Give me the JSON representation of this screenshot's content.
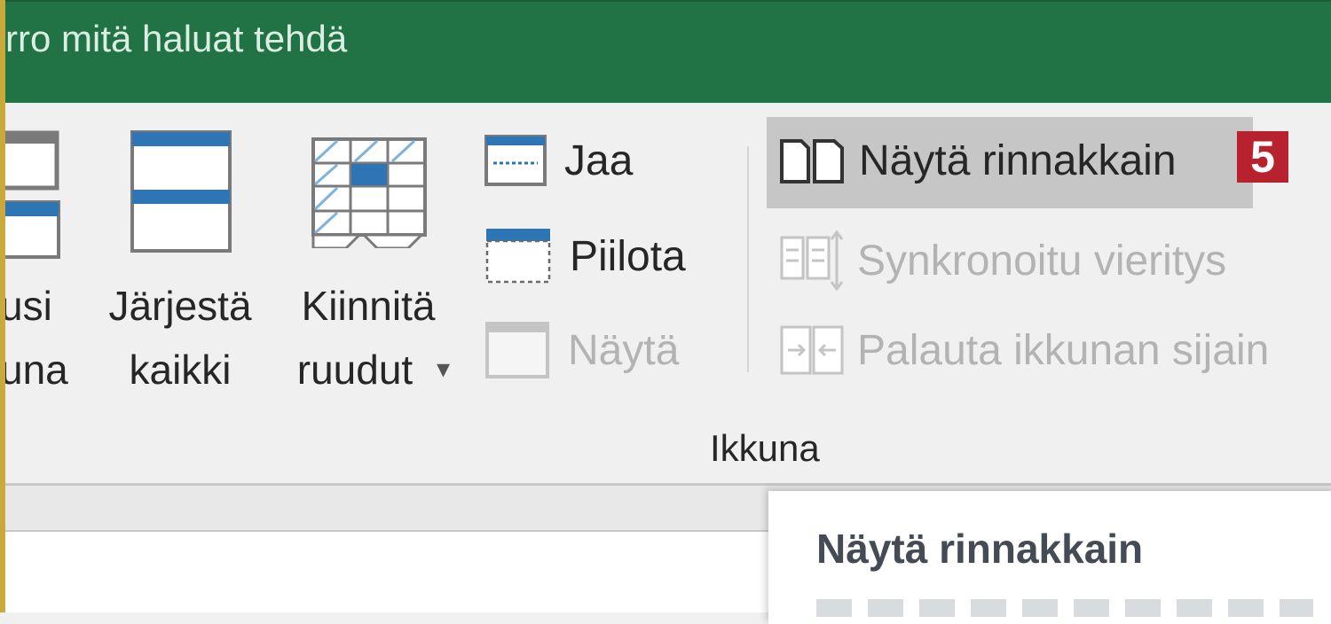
{
  "title_bar": {
    "tell_me_text": "rro mitä haluat tehdä"
  },
  "ribbon": {
    "new_window": {
      "line1": "usi",
      "line2": "una"
    },
    "arrange_all": {
      "line1": "Järjestä",
      "line2": "kaikki"
    },
    "freeze_panes": {
      "line1": "Kiinnitä",
      "line2": "ruudut",
      "dropdown_glyph": "▾"
    },
    "split": {
      "label": "Jaa"
    },
    "hide": {
      "label": "Piilota"
    },
    "unhide": {
      "label": "Näytä",
      "disabled": true
    },
    "view_side_by_side": {
      "label": "Näytä rinnakkain",
      "highlighted": true
    },
    "sync_scrolling": {
      "label": "Synkronoitu vieritys",
      "disabled": true
    },
    "reset_window_position": {
      "label": "Palauta ikkunan sijain",
      "disabled": true
    },
    "group_label": "Ikkuna",
    "step_badge": "5"
  },
  "tooltip": {
    "title": "Näytä rinnakkain"
  },
  "colors": {
    "accent_green": "#217346",
    "badge_red": "#b8222e",
    "icon_blue": "#2e75b6"
  }
}
